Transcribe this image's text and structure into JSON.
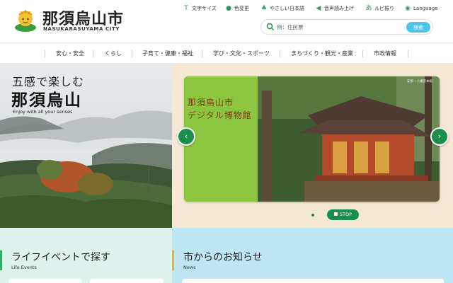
{
  "header": {
    "logo_title": "那須烏山市",
    "logo_sub": "NASUKARASUYAMA CITY",
    "utilities": [
      {
        "label": "文字サイズ",
        "icon": "text-size-icon"
      },
      {
        "label": "色変更",
        "icon": "palette-icon"
      },
      {
        "label": "やさしい日本語",
        "icon": "easy-japanese-icon"
      },
      {
        "label": "音声読み上げ",
        "icon": "speaker-icon"
      },
      {
        "label": "ルビ振り",
        "icon": "ruby-icon"
      },
      {
        "label": "Language",
        "icon": "globe-icon"
      }
    ],
    "search": {
      "placeholder": "例：住民票",
      "button_label": "検索"
    }
  },
  "nav": {
    "items": [
      {
        "label": "安心・安全"
      },
      {
        "label": "くらし"
      },
      {
        "label": "子育て・健康・福祉"
      },
      {
        "label": "学び・文化・スポーツ"
      },
      {
        "label": "まちづくり・観光・産業"
      },
      {
        "label": "市政情報"
      }
    ]
  },
  "hero": {
    "tagline_1": "五感で楽しむ",
    "tagline_2": "那須烏山",
    "tagline_en": "Enjoy with all your senses"
  },
  "slider": {
    "title_line1": "那須烏山市",
    "title_line2": "デジタル博物館",
    "caption": "安那・八幡宮本殿",
    "prev_label": "‹",
    "next_label": "›",
    "stop_label": "STOP"
  },
  "sections": {
    "life_title": "ライフイベントで探す",
    "life_sub": "Life Events",
    "news_title": "市からのお知らせ",
    "news_sub": "News"
  },
  "colors": {
    "brand_green": "#1a8f4c",
    "accent_blue": "#4fc3e8",
    "slide_green": "#8cc63f"
  }
}
